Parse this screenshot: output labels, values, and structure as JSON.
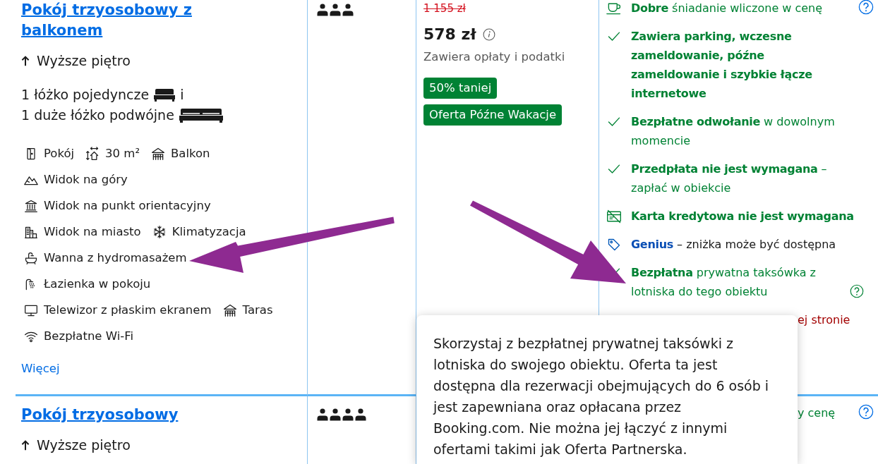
{
  "rooms": [
    {
      "title": "Pokój trzyosobowy z balkonem",
      "floor": "Wyższe piętro",
      "beds": [
        {
          "kind": "single",
          "text": "1 łóżko pojedyncze",
          "joiner": "i"
        },
        {
          "kind": "double",
          "text": "1 duże łóżko podwójne"
        }
      ],
      "facility_rows": [
        [
          {
            "kind": "room",
            "label": "Pokój"
          },
          {
            "kind": "size",
            "label": "30 m²"
          },
          {
            "kind": "balcony",
            "label": "Balkon"
          }
        ],
        [
          {
            "kind": "mountain-view",
            "label": "Widok na góry"
          }
        ],
        [
          {
            "kind": "landmark-view",
            "label": "Widok na punkt orientacyjny"
          }
        ],
        [
          {
            "kind": "city-view",
            "label": "Widok na miasto"
          },
          {
            "kind": "air-conditioning",
            "label": "Klimatyzacja"
          }
        ],
        [
          {
            "kind": "hot-tub",
            "label": "Wanna z hydromasażem"
          }
        ],
        [
          {
            "kind": "bathroom",
            "label": "Łazienka w pokoju"
          }
        ],
        [
          {
            "kind": "tv",
            "label": "Telewizor z płaskim ekranem"
          },
          {
            "kind": "terrace",
            "label": "Taras"
          }
        ],
        [
          {
            "kind": "wifi",
            "label": "Bezpłatne Wi-Fi"
          }
        ]
      ],
      "more_link": "Więcej",
      "guests": [
        {
          "kind": "adult"
        },
        {
          "kind": "adult"
        },
        {
          "kind": "adult"
        }
      ],
      "price": {
        "original": "1 155 zł",
        "current": "578 zł",
        "note": "Zawiera opłaty i podatki",
        "badges": [
          "50% taniej",
          "Oferta Późne Wakacje"
        ]
      },
      "conditions": [
        {
          "kind": "breakfast",
          "text": "**Dobre** śniadanie wliczone w cenę",
          "color": "#008234",
          "bold": false,
          "help": {
            "kind": "aside"
          }
        },
        {
          "kind": "perk",
          "text": "Zawiera parking, wczesne zameldowanie, późne zameldowanie i szybkie łącze internetowe",
          "color": "#008234",
          "bold": true
        },
        {
          "kind": "perk",
          "text": "**Bezpłatne odwołanie** w dowolnym momencie",
          "color": "#008234",
          "bold": false
        },
        {
          "kind": "perk",
          "text": "**Przedpłata nie jest wymagana** – zapłać w obiekcie",
          "color": "#008234",
          "bold": false
        },
        {
          "kind": "no-card",
          "text": "Karta kredytowa nie jest wymagana",
          "color": "#008234",
          "bold": true
        },
        {
          "kind": "genius",
          "text": "**Genius** – zniżka może być dostępna",
          "color": "#1a1a1a",
          "bold": false
        },
        {
          "kind": "perk",
          "text": "**Bezpłatna** prywatna taksówka z lotniska do tego obiektu",
          "color": "#008234",
          "bold": false,
          "help": {
            "kind": "inline"
          }
        },
        {
          "kind": "partial",
          "text": "ej stronie",
          "color": "#a30000",
          "bold": false
        }
      ]
    },
    {
      "title": "Pokój trzyosobowy",
      "floor": "Wyższe piętro",
      "guests": [
        {
          "kind": "adult"
        },
        {
          "kind": "adult"
        },
        {
          "kind": "adult"
        },
        {
          "kind": "adult"
        }
      ],
      "conditions": [
        {
          "kind": "partial",
          "text": "y cenę",
          "color": "#008234",
          "bold": false,
          "help": {
            "kind": "aside"
          }
        }
      ]
    }
  ],
  "tooltip": {
    "text": "Skorzystaj z bezpłatnej prywatnej taksówki z lotniska do swojego obiektu. Oferta ta jest dostępna dla rezerwacji obejmujących do 6 osób i jest zapewniana oraz opłacana przez Booking.com. Nie można jej łączyć z innymi ofertami takimi jak Oferta Partnerska."
  }
}
